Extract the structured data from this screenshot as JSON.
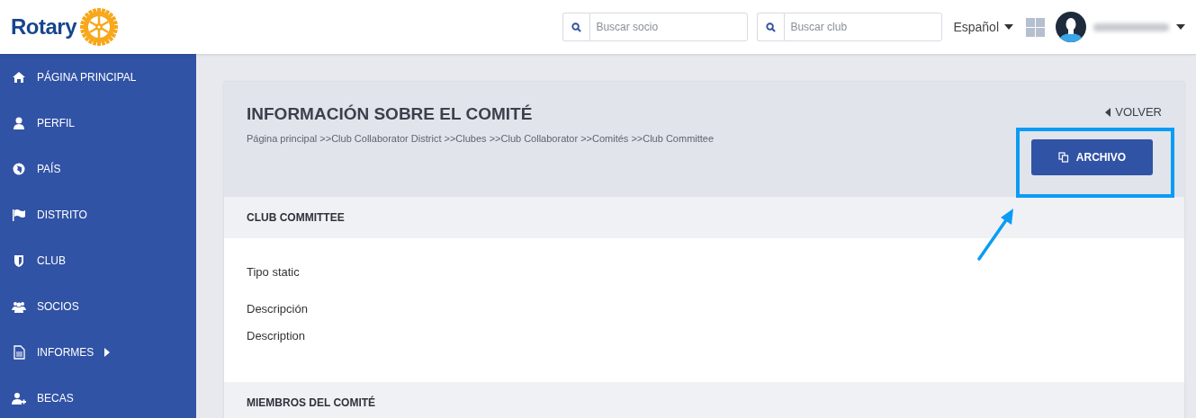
{
  "header": {
    "logo_text": "Rotary",
    "search_member": {
      "placeholder": "Buscar socio"
    },
    "search_club": {
      "placeholder": "Buscar club"
    },
    "language": "Español"
  },
  "sidebar": {
    "items": [
      {
        "label": "PÁGINA PRINCIPAL",
        "submenu": false
      },
      {
        "label": "PERFIL",
        "submenu": false
      },
      {
        "label": "PAÍS",
        "submenu": false
      },
      {
        "label": "DISTRITO",
        "submenu": false
      },
      {
        "label": "CLUB",
        "submenu": false
      },
      {
        "label": "SOCIOS",
        "submenu": false
      },
      {
        "label": "INFORMES",
        "submenu": true
      },
      {
        "label": "BECAS",
        "submenu": false
      }
    ]
  },
  "page": {
    "title": "INFORMACIÓN SOBRE EL COMITÉ",
    "back": "VOLVER",
    "breadcrumb": [
      "Página principal",
      "Club Collaborator District",
      "Clubes",
      "Club Collaborator",
      "Comités",
      "Club Committee"
    ],
    "separator": ">>",
    "archive_button": "ARCHIVO"
  },
  "sections": [
    {
      "title": "CLUB COMMITTEE",
      "fields": [
        {
          "label": "Tipo static"
        },
        {
          "label": "Descripción",
          "value": "Description"
        }
      ]
    },
    {
      "title": "MIEMBROS DEL COMITÉ"
    }
  ]
}
